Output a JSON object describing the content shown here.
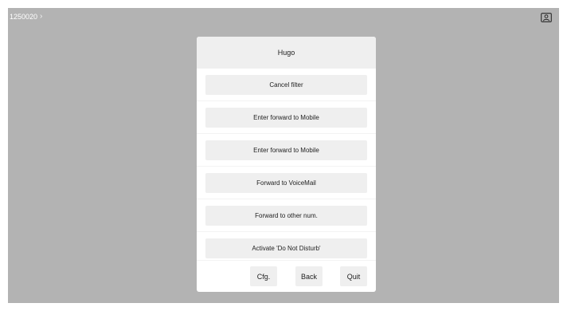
{
  "topbar": {
    "number": "1250020",
    "chevron": "›",
    "contact_icon": "contact-card-icon"
  },
  "dialog": {
    "title": "Hugo",
    "items": [
      {
        "label": "Cancel filter"
      },
      {
        "label": "Enter forward to Mobile"
      },
      {
        "label": "Enter forward to Mobile"
      },
      {
        "label": "Forward to VoiceMail"
      },
      {
        "label": "Forward to other num."
      },
      {
        "label": "Activate 'Do Not Disturb'"
      }
    ],
    "softkeys": {
      "cfg": "Cfg.",
      "back": "Back",
      "quit": "Quit"
    }
  },
  "colors": {
    "background": "#b3b3b3",
    "dialog": "#ffffff",
    "button": "#efefef",
    "text": "#222222"
  }
}
